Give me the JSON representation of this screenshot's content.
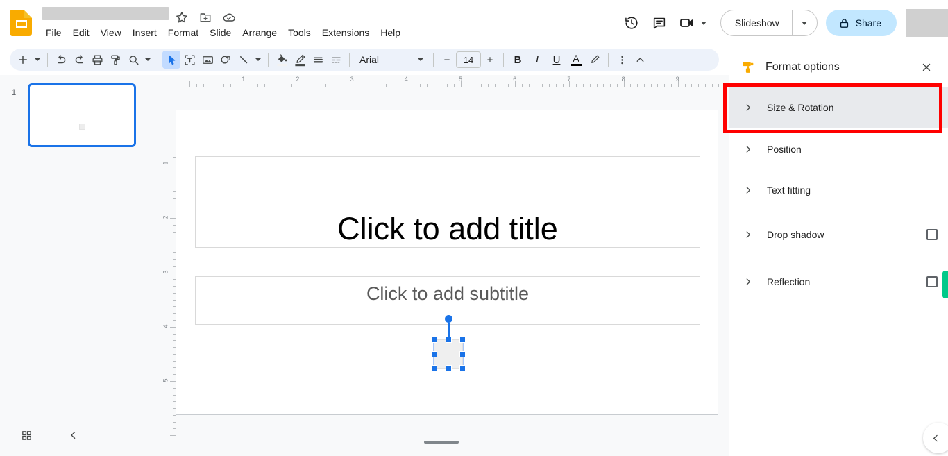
{
  "app": {
    "name": "Google Slides",
    "logo_icon": "slides-logo-icon",
    "document_title": "",
    "title_redacted": true
  },
  "title_bar": {
    "icons": [
      {
        "name": "star-icon",
        "label": "Star"
      },
      {
        "name": "move-to-folder-icon",
        "label": "Move"
      },
      {
        "name": "cloud-saved-icon",
        "label": "Saved to Drive"
      }
    ]
  },
  "menubar": {
    "items": [
      {
        "label": "File"
      },
      {
        "label": "Edit"
      },
      {
        "label": "View"
      },
      {
        "label": "Insert"
      },
      {
        "label": "Format"
      },
      {
        "label": "Slide"
      },
      {
        "label": "Arrange"
      },
      {
        "label": "Tools"
      },
      {
        "label": "Extensions"
      },
      {
        "label": "Help"
      }
    ]
  },
  "top_right": {
    "history_icon": "version-history-icon",
    "comment_icon": "comment-icon",
    "meet_icon": "video-camera-icon",
    "slideshow_label": "Slideshow",
    "slideshow_caret_icon": "chevron-down-icon",
    "share_label": "Share",
    "share_lock_icon": "lock-icon",
    "avatar_redacted": true
  },
  "toolbar": {
    "items": [
      {
        "name": "new-slide-button",
        "icon": "plus-icon",
        "label": "New slide"
      },
      {
        "name": "new-slide-caret",
        "icon": "caret-down-icon",
        "label": "New slide options"
      },
      {
        "name": "undo-button",
        "icon": "undo-icon",
        "label": "Undo"
      },
      {
        "name": "redo-button",
        "icon": "redo-icon",
        "label": "Redo"
      },
      {
        "name": "print-button",
        "icon": "printer-icon",
        "label": "Print"
      },
      {
        "name": "paint-format-button",
        "icon": "paint-format-icon",
        "label": "Paint format"
      },
      {
        "name": "zoom-button",
        "icon": "magnifier-icon",
        "label": "Zoom"
      },
      {
        "name": "zoom-caret",
        "icon": "caret-down-icon",
        "label": "Zoom options"
      },
      {
        "name": "select-tool-button",
        "icon": "cursor-arrow-icon",
        "label": "Select",
        "active": true
      },
      {
        "name": "text-box-button",
        "icon": "text-box-icon",
        "label": "Text box"
      },
      {
        "name": "insert-image-button",
        "icon": "image-icon",
        "label": "Insert image"
      },
      {
        "name": "shape-button",
        "icon": "shape-icon",
        "label": "Shape"
      },
      {
        "name": "line-button",
        "icon": "line-icon",
        "label": "Line"
      },
      {
        "name": "line-caret",
        "icon": "caret-down-icon",
        "label": "Line options"
      },
      {
        "name": "fill-color-button",
        "icon": "paint-bucket-icon",
        "label": "Fill color"
      },
      {
        "name": "border-color-button",
        "icon": "pen-icon",
        "label": "Border color"
      },
      {
        "name": "border-weight-button",
        "icon": "border-weight-icon",
        "label": "Border weight"
      },
      {
        "name": "border-dash-button",
        "icon": "border-dash-icon",
        "label": "Border dash"
      }
    ],
    "font_family": "Arial",
    "font_size": "14",
    "decrease_font_label": "−",
    "increase_font_label": "+",
    "bold_label": "B",
    "italic_label": "I",
    "underline_label": "U",
    "text_color_label": "A",
    "highlight_icon": "highlight-pen-icon",
    "more_icon": "more-vertical-icon",
    "collapse_icon": "chevron-up-icon"
  },
  "filmstrip": {
    "slides": [
      {
        "number": "1",
        "selected": true
      }
    ],
    "grid_view_icon": "grid-view-icon",
    "collapse_icon": "chevron-left-icon"
  },
  "canvas": {
    "ruler_horizontal_labels": [
      "1",
      "2",
      "3",
      "4",
      "5",
      "6",
      "7",
      "8",
      "9"
    ],
    "ruler_vertical_labels": [
      "1",
      "2",
      "3",
      "4",
      "5"
    ],
    "title_placeholder": "Click to add title",
    "subtitle_placeholder": "Click to add subtitle",
    "selected_object": {
      "name": "selected-square-shape",
      "handles": 8,
      "rotation_handle": true,
      "handle_color": "#1a73e8"
    }
  },
  "format_panel": {
    "icon": "paint-roller-icon",
    "title": "Format options",
    "close_icon": "close-icon",
    "rows": [
      {
        "label": "Size & Rotation",
        "expand_icon": "chevron-right-icon",
        "selected": true,
        "has_checkbox": false,
        "checked": false
      },
      {
        "label": "Position",
        "expand_icon": "chevron-right-icon",
        "selected": false,
        "has_checkbox": false,
        "checked": false
      },
      {
        "label": "Text fitting",
        "expand_icon": "chevron-right-icon",
        "selected": false,
        "has_checkbox": false,
        "checked": false
      },
      {
        "label": "Drop shadow",
        "expand_icon": "chevron-right-icon",
        "selected": false,
        "has_checkbox": true,
        "checked": false
      },
      {
        "label": "Reflection",
        "expand_icon": "chevron-right-icon",
        "selected": false,
        "has_checkbox": true,
        "checked": false
      }
    ]
  },
  "annotation": {
    "highlight_color": "#ff0000",
    "target": "Size & Rotation"
  },
  "side_widgets": {
    "green_tab_color": "#00c989",
    "corner_expand_icon": "chevron-left-icon"
  }
}
